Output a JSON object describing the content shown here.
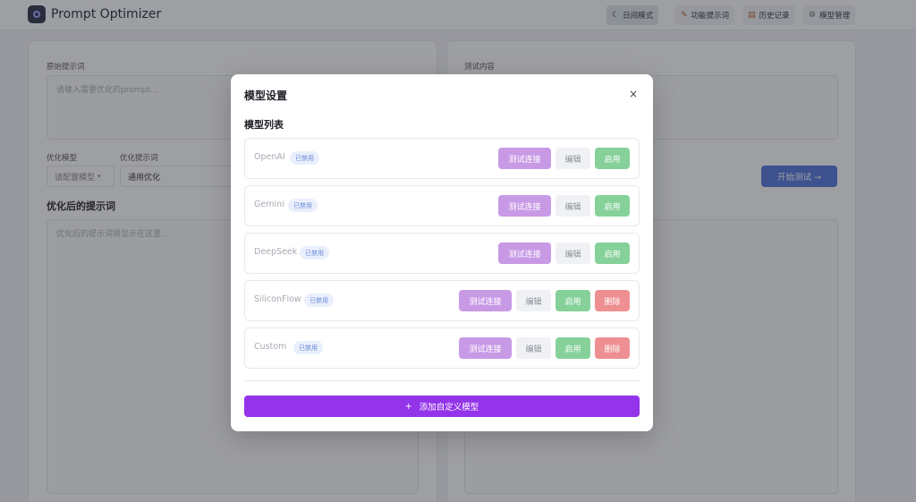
{
  "header": {
    "app_title": "Prompt Optimizer",
    "nav": [
      {
        "label": "日间模式",
        "icon": "moon-icon",
        "glyph": "☾"
      },
      {
        "label": "功能提示词",
        "icon": "pencil-icon",
        "glyph": "✎"
      },
      {
        "label": "历史记录",
        "icon": "scroll-icon",
        "glyph": "▤"
      },
      {
        "label": "模型管理",
        "icon": "gear-icon",
        "glyph": "⚙"
      }
    ]
  },
  "left": {
    "prompt_label": "原始提示词",
    "prompt_placeholder": "请输入需要优化的prompt...",
    "model_label": "优化模型",
    "model_value": "请配置模型",
    "template_label": "优化提示词",
    "template_value": "通用优化",
    "result_heading": "优化后的提示词",
    "result_placeholder": "优化后的提示词将显示在这里..."
  },
  "right": {
    "test_label": "测试内容",
    "start_button": "开始测试 →"
  },
  "modal": {
    "title": "模型设置",
    "close": "×",
    "list_title": "模型列表",
    "models": [
      {
        "name": "OpenAI",
        "status": "已禁用",
        "test": "测试连接",
        "edit": "编辑",
        "enable": "启用"
      },
      {
        "name": "Gemini",
        "status": "已禁用",
        "test": "测试连接",
        "edit": "编辑",
        "enable": "启用"
      },
      {
        "name": "DeepSeek",
        "status": "已禁用",
        "test": "测试连接",
        "edit": "编辑",
        "enable": "启用"
      },
      {
        "name": "SiliconFlow",
        "status": "已禁用",
        "test": "测试连接",
        "edit": "编辑",
        "enable": "启用",
        "delete": "删除"
      },
      {
        "name": "Custom",
        "status": "已禁用",
        "test": "测试连接",
        "edit": "编辑",
        "enable": "启用",
        "delete": "删除"
      }
    ],
    "add_button": "添加自定义模型",
    "add_icon": "+"
  },
  "colors": {
    "accent_purple": "#9333ea",
    "test_button": "#c89ae6",
    "enable_button": "#86d19a",
    "delete_button": "#ee8f92",
    "start_button": "#4f73d9"
  }
}
